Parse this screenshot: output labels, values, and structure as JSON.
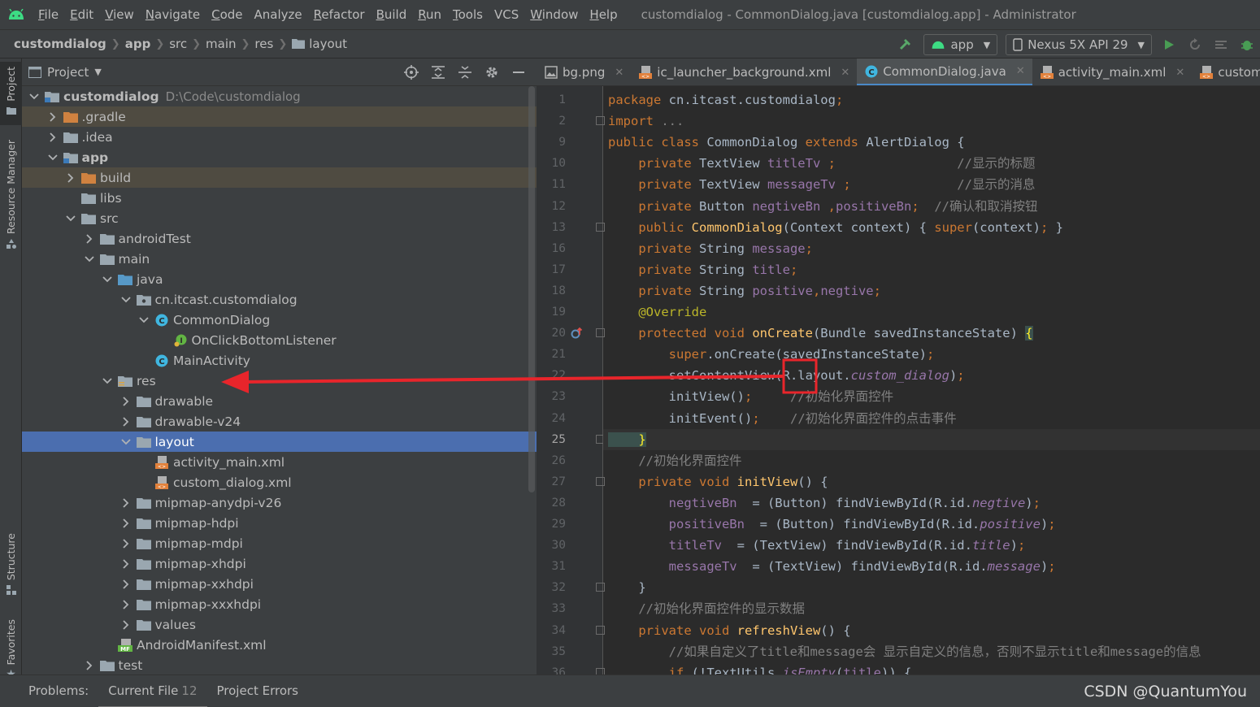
{
  "window": {
    "title": "customdialog - CommonDialog.java [customdialog.app] - Administrator",
    "menu": [
      {
        "label": "File",
        "u": "F",
        "rest": "ile"
      },
      {
        "label": "Edit",
        "u": "E",
        "rest": "dit"
      },
      {
        "label": "View",
        "u": "V",
        "rest": "iew"
      },
      {
        "label": "Navigate",
        "u": "N",
        "rest": "avigate"
      },
      {
        "label": "Code",
        "u": "C",
        "rest": "ode"
      },
      {
        "label": "Analyze",
        "u": "",
        "rest": "Analyze"
      },
      {
        "label": "Refactor",
        "u": "R",
        "rest": "efactor"
      },
      {
        "label": "Build",
        "u": "B",
        "rest": "uild"
      },
      {
        "label": "Run",
        "u": "R",
        "rest": "un"
      },
      {
        "label": "Tools",
        "u": "T",
        "rest": "ools"
      },
      {
        "label": "VCS",
        "u": "",
        "rest": "VCS"
      },
      {
        "label": "Window",
        "u": "W",
        "rest": "indow"
      },
      {
        "label": "Help",
        "u": "H",
        "rest": "elp"
      }
    ]
  },
  "navbar": {
    "crumbs": [
      {
        "label": "customdialog",
        "bold": true
      },
      {
        "label": "app",
        "bold": true
      },
      {
        "label": "src",
        "bold": false
      },
      {
        "label": "main",
        "bold": false
      },
      {
        "label": "res",
        "bold": false
      },
      {
        "label": "layout",
        "bold": false
      }
    ],
    "run_config": "app",
    "device": "Nexus 5X API 29"
  },
  "side_tabs": {
    "project": "Project",
    "resource_manager": "Resource Manager",
    "structure": "Structure",
    "favorites": "Favorites"
  },
  "project_panel": {
    "title": "Project",
    "root_path": "D:\\Code\\customdialog",
    "tree": [
      {
        "label": "customdialog",
        "depth": 0,
        "icon": "module",
        "chev": "down",
        "bold": true
      },
      {
        "label": ".gradle",
        "depth": 1,
        "icon": "folder-orange",
        "chev": "right",
        "state": "hl"
      },
      {
        "label": ".idea",
        "depth": 1,
        "icon": "folder",
        "chev": "right"
      },
      {
        "label": "app",
        "depth": 1,
        "icon": "module",
        "chev": "down",
        "bold": true
      },
      {
        "label": "build",
        "depth": 2,
        "icon": "folder-orange",
        "chev": "right",
        "state": "hl"
      },
      {
        "label": "libs",
        "depth": 2,
        "icon": "folder",
        "chev": "none"
      },
      {
        "label": "src",
        "depth": 2,
        "icon": "folder",
        "chev": "down"
      },
      {
        "label": "androidTest",
        "depth": 3,
        "icon": "folder",
        "chev": "right"
      },
      {
        "label": "main",
        "depth": 3,
        "icon": "folder",
        "chev": "down"
      },
      {
        "label": "java",
        "depth": 4,
        "icon": "folder-blue",
        "chev": "down"
      },
      {
        "label": "cn.itcast.customdialog",
        "depth": 5,
        "icon": "package",
        "chev": "down"
      },
      {
        "label": "CommonDialog",
        "depth": 6,
        "icon": "class",
        "chev": "down"
      },
      {
        "label": "OnClickBottomListener",
        "depth": 7,
        "icon": "interface",
        "chev": "none"
      },
      {
        "label": "MainActivity",
        "depth": 6,
        "icon": "class",
        "chev": "none"
      },
      {
        "label": "res",
        "depth": 4,
        "icon": "folder-res",
        "chev": "down"
      },
      {
        "label": "drawable",
        "depth": 5,
        "icon": "folder",
        "chev": "right"
      },
      {
        "label": "drawable-v24",
        "depth": 5,
        "icon": "folder",
        "chev": "right"
      },
      {
        "label": "layout",
        "depth": 5,
        "icon": "folder",
        "chev": "down",
        "state": "sel"
      },
      {
        "label": "activity_main.xml",
        "depth": 6,
        "icon": "xml",
        "chev": "none"
      },
      {
        "label": "custom_dialog.xml",
        "depth": 6,
        "icon": "xml",
        "chev": "none"
      },
      {
        "label": "mipmap-anydpi-v26",
        "depth": 5,
        "icon": "folder",
        "chev": "right"
      },
      {
        "label": "mipmap-hdpi",
        "depth": 5,
        "icon": "folder",
        "chev": "right"
      },
      {
        "label": "mipmap-mdpi",
        "depth": 5,
        "icon": "folder",
        "chev": "right"
      },
      {
        "label": "mipmap-xhdpi",
        "depth": 5,
        "icon": "folder",
        "chev": "right"
      },
      {
        "label": "mipmap-xxhdpi",
        "depth": 5,
        "icon": "folder",
        "chev": "right"
      },
      {
        "label": "mipmap-xxxhdpi",
        "depth": 5,
        "icon": "folder",
        "chev": "right"
      },
      {
        "label": "values",
        "depth": 5,
        "icon": "folder",
        "chev": "right"
      },
      {
        "label": "AndroidManifest.xml",
        "depth": 4,
        "icon": "manifest",
        "chev": "none"
      },
      {
        "label": "test",
        "depth": 3,
        "icon": "folder",
        "chev": "right"
      }
    ]
  },
  "editor": {
    "tabs": [
      {
        "label": "bg.png",
        "icon": "image",
        "active": false
      },
      {
        "label": "ic_launcher_background.xml",
        "icon": "xml",
        "active": false
      },
      {
        "label": "CommonDialog.java",
        "icon": "class",
        "active": true
      },
      {
        "label": "activity_main.xml",
        "icon": "xml",
        "active": false
      },
      {
        "label": "custom_d",
        "icon": "xml",
        "active": false
      }
    ],
    "current_line": "25",
    "lines": [
      {
        "n": "1",
        "fold": false,
        "segs": [
          [
            "kw",
            "package "
          ],
          [
            "",
            "cn.itcast.customdialog"
          ],
          [
            "kw",
            ";"
          ]
        ]
      },
      {
        "n": "2",
        "fold": true,
        "segs": [
          [
            "kw",
            "import "
          ],
          [
            "cm",
            "..."
          ]
        ]
      },
      {
        "n": "9",
        "fold": false,
        "segs": [
          [
            "kw",
            "public class "
          ],
          [
            "",
            "CommonDialog "
          ],
          [
            "kw",
            "extends "
          ],
          [
            "",
            "AlertDialog {"
          ]
        ]
      },
      {
        "n": "10",
        "fold": false,
        "segs": [
          [
            "kw",
            "    private "
          ],
          [
            "",
            "TextView "
          ],
          [
            "fld",
            "titleTv "
          ],
          [
            "kw",
            ";"
          ],
          [
            "cm",
            "                //显示的标题"
          ]
        ]
      },
      {
        "n": "11",
        "fold": false,
        "segs": [
          [
            "kw",
            "    private "
          ],
          [
            "",
            "TextView "
          ],
          [
            "fld",
            "messageTv "
          ],
          [
            "kw",
            ";"
          ],
          [
            "cm",
            "              //显示的消息"
          ]
        ]
      },
      {
        "n": "12",
        "fold": false,
        "segs": [
          [
            "kw",
            "    private "
          ],
          [
            "",
            "Button "
          ],
          [
            "fld",
            "negtiveBn "
          ],
          [
            "kw",
            ","
          ],
          [
            "fld",
            "positiveBn"
          ],
          [
            "kw",
            ";"
          ],
          [
            "cm",
            "  //确认和取消按钮"
          ]
        ]
      },
      {
        "n": "13",
        "fold": true,
        "segs": [
          [
            "kw",
            "    public "
          ],
          [
            "fn",
            "CommonDialog"
          ],
          [
            "",
            "(Context context) { "
          ],
          [
            "kw",
            "super"
          ],
          [
            "",
            "(context)"
          ],
          [
            "kw",
            ";"
          ],
          [
            "",
            " }"
          ]
        ]
      },
      {
        "n": "16",
        "fold": false,
        "segs": [
          [
            "kw",
            "    private "
          ],
          [
            "",
            "String "
          ],
          [
            "fld",
            "message"
          ],
          [
            "kw",
            ";"
          ]
        ]
      },
      {
        "n": "17",
        "fold": false,
        "segs": [
          [
            "kw",
            "    private "
          ],
          [
            "",
            "String "
          ],
          [
            "fld",
            "title"
          ],
          [
            "kw",
            ";"
          ]
        ]
      },
      {
        "n": "18",
        "fold": false,
        "segs": [
          [
            "kw",
            "    private "
          ],
          [
            "",
            "String "
          ],
          [
            "fld",
            "positive"
          ],
          [
            "kw",
            ","
          ],
          [
            "fld",
            "negtive"
          ],
          [
            "kw",
            ";"
          ]
        ]
      },
      {
        "n": "19",
        "fold": false,
        "segs": [
          [
            "ann",
            "    @Override"
          ]
        ]
      },
      {
        "n": "20",
        "fold": true,
        "segs": [
          [
            "kw",
            "    protected void "
          ],
          [
            "fn",
            "onCreate"
          ],
          [
            "",
            "(Bundle savedInstanceState) "
          ],
          [
            "brk",
            "{"
          ]
        ]
      },
      {
        "n": "21",
        "fold": false,
        "segs": [
          [
            "kw",
            "        super"
          ],
          [
            "",
            ".onCreate(savedInstanceState)"
          ],
          [
            "kw",
            ";"
          ]
        ]
      },
      {
        "n": "22",
        "fold": false,
        "segs": [
          [
            "",
            "        setContentView(R.layout."
          ],
          [
            "ital",
            "custom_dialog"
          ],
          [
            "",
            ")"
          ],
          [
            "kw",
            ";"
          ]
        ]
      },
      {
        "n": "23",
        "fold": false,
        "segs": [
          [
            "",
            "        initView()"
          ],
          [
            "kw",
            ";"
          ],
          [
            "cm",
            "     //初始化界面控件"
          ]
        ]
      },
      {
        "n": "24",
        "fold": false,
        "segs": [
          [
            "",
            "        initEvent()"
          ],
          [
            "kw",
            ";"
          ],
          [
            "cm",
            "    //初始化界面控件的点击事件"
          ]
        ]
      },
      {
        "n": "25",
        "fold": true,
        "segs": [
          [
            "brk",
            "    }"
          ]
        ]
      },
      {
        "n": "26",
        "fold": false,
        "segs": [
          [
            "cm",
            "    //初始化界面控件"
          ]
        ]
      },
      {
        "n": "27",
        "fold": true,
        "segs": [
          [
            "kw",
            "    private void "
          ],
          [
            "fn",
            "initView"
          ],
          [
            "",
            "() {"
          ]
        ]
      },
      {
        "n": "28",
        "fold": false,
        "segs": [
          [
            "fld",
            "        negtiveBn "
          ],
          [
            "",
            " = (Button) findViewById(R.id."
          ],
          [
            "ital",
            "negtive"
          ],
          [
            "",
            ")"
          ],
          [
            "kw",
            ";"
          ]
        ]
      },
      {
        "n": "29",
        "fold": false,
        "segs": [
          [
            "fld",
            "        positiveBn "
          ],
          [
            "",
            " = (Button) findViewById(R.id."
          ],
          [
            "ital",
            "positive"
          ],
          [
            "",
            ")"
          ],
          [
            "kw",
            ";"
          ]
        ]
      },
      {
        "n": "30",
        "fold": false,
        "segs": [
          [
            "fld",
            "        titleTv "
          ],
          [
            "",
            " = (TextView) findViewById(R.id."
          ],
          [
            "ital",
            "title"
          ],
          [
            "",
            ")"
          ],
          [
            "kw",
            ";"
          ]
        ]
      },
      {
        "n": "31",
        "fold": false,
        "segs": [
          [
            "fld",
            "        messageTv "
          ],
          [
            "",
            " = (TextView) findViewById(R.id."
          ],
          [
            "ital",
            "message"
          ],
          [
            "",
            ")"
          ],
          [
            "kw",
            ";"
          ]
        ]
      },
      {
        "n": "32",
        "fold": true,
        "segs": [
          [
            "",
            "    }"
          ]
        ]
      },
      {
        "n": "33",
        "fold": false,
        "segs": [
          [
            "cm",
            "    //初始化界面控件的显示数据"
          ]
        ]
      },
      {
        "n": "34",
        "fold": true,
        "segs": [
          [
            "kw",
            "    private void "
          ],
          [
            "fn",
            "refreshView"
          ],
          [
            "",
            "() {"
          ]
        ]
      },
      {
        "n": "35",
        "fold": false,
        "segs": [
          [
            "cm",
            "        //如果自定义了title和message会 显示自定义的信息，否则不显示title和message的信息"
          ]
        ]
      },
      {
        "n": "36",
        "fold": true,
        "segs": [
          [
            "kw",
            "        if "
          ],
          [
            "",
            "(!TextUtils."
          ],
          [
            "ital",
            "isEmpty"
          ],
          [
            "",
            "("
          ],
          [
            "fld",
            "title"
          ],
          [
            "",
            "))"
          ],
          [
            "",
            " {"
          ]
        ]
      }
    ]
  },
  "bottom": {
    "problems": "Problems:",
    "current_file": "Current File",
    "current_file_count": "12",
    "project_errors": "Project Errors",
    "watermark": "CSDN @QuantumYou"
  },
  "colors": {
    "annotation_red": "#e8252b",
    "selection": "#4b6eaf",
    "keyword": "#cc7832"
  }
}
